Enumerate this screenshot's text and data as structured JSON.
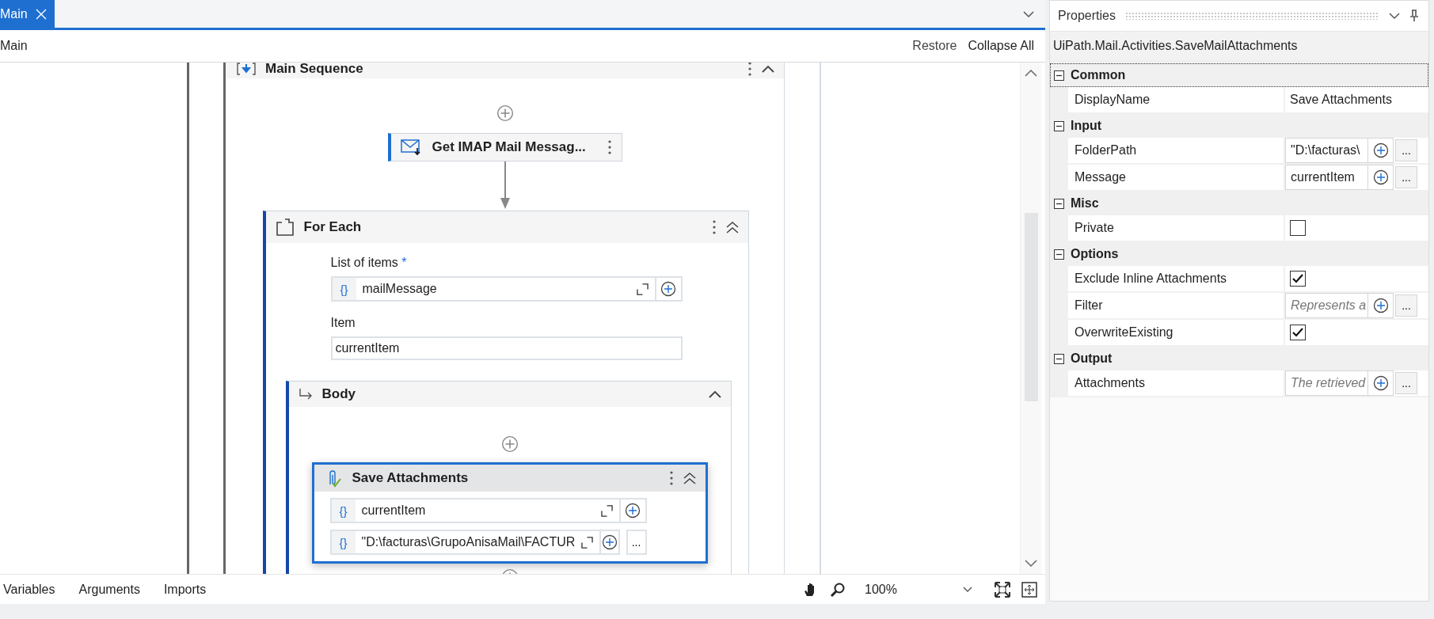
{
  "tabs": [
    {
      "label": "Main",
      "selected": true
    }
  ],
  "breadcrumb": "Main",
  "designer_actions": [
    "Restore",
    "Collapse All"
  ],
  "workflow": {
    "sequence_title": "Main Sequence",
    "first_activity": "Get IMAP Mail Messag...",
    "for_each": {
      "title": "For Each",
      "list_label": "List of items",
      "required_mark": "*",
      "list_prefix": "{}",
      "list_value": "mailMessage",
      "item_label": "Item",
      "item_value": "currentItem",
      "body": {
        "title": "Body",
        "activity": {
          "title": "Save Attachments",
          "selected": true,
          "inputs": [
            {
              "prefix": "{}",
              "value": "currentItem"
            },
            {
              "prefix": "{}",
              "value": "\"D:\\facturas\\GrupoAnisaMail\\FACTUR",
              "more": "..."
            }
          ]
        }
      }
    }
  },
  "bottom_tabs": [
    "Variables",
    "Arguments",
    "Imports"
  ],
  "zoom": "100%",
  "properties": {
    "title": "Properties",
    "type_name": "UiPath.Mail.Activities.SaveMailAttachments",
    "categories": [
      {
        "name": "Common",
        "expanded": true,
        "focused": true,
        "properties": [
          {
            "name": "DisplayName",
            "kind": "text",
            "value": "Save Attachments"
          }
        ]
      },
      {
        "name": "Input",
        "expanded": true,
        "focused": false,
        "properties": [
          {
            "name": "FolderPath",
            "kind": "expression",
            "value": "\"D:\\facturas\\",
            "more": "..."
          },
          {
            "name": "Message",
            "kind": "expression",
            "value": "currentItem",
            "more": "..."
          }
        ]
      },
      {
        "name": "Misc",
        "expanded": true,
        "focused": false,
        "properties": [
          {
            "name": "Private",
            "kind": "checkbox",
            "checked": false
          }
        ]
      },
      {
        "name": "Options",
        "expanded": true,
        "focused": false,
        "properties": [
          {
            "name": "Exclude Inline Attachments",
            "kind": "checkbox",
            "checked": true
          },
          {
            "name": "Filter",
            "kind": "expression",
            "placeholder": "Represents a",
            "more": "..."
          },
          {
            "name": "OverwriteExisting",
            "kind": "checkbox",
            "checked": true
          }
        ]
      },
      {
        "name": "Output",
        "expanded": true,
        "focused": false,
        "properties": [
          {
            "name": "Attachments",
            "kind": "expression",
            "placeholder": "The retrieved",
            "more": "..."
          }
        ]
      }
    ]
  }
}
